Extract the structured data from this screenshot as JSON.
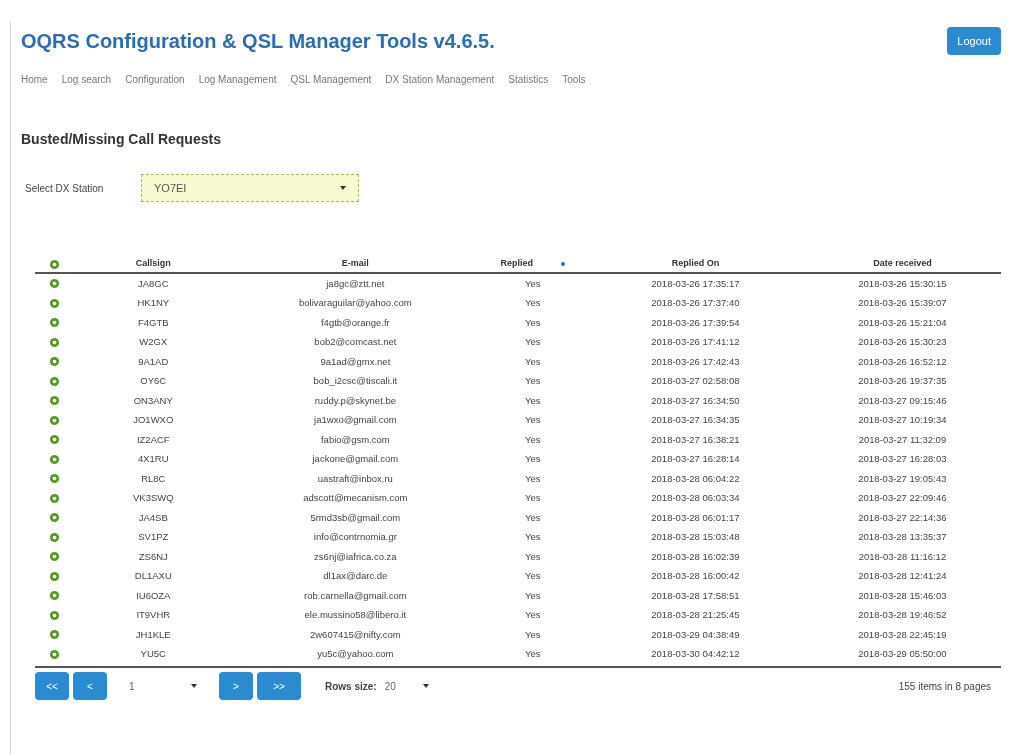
{
  "app_title": "OQRS Configuration & QSL Manager Tools v4.6.5.",
  "logout_button": "Logout",
  "nav": [
    {
      "label": "Home",
      "selected": false
    },
    {
      "label": "Log search",
      "selected": false
    },
    {
      "label": "Configuration",
      "selected": false
    },
    {
      "label": "Log Management",
      "selected": false
    },
    {
      "label": "QSL Management",
      "selected": false
    },
    {
      "label": "DX Station Management",
      "selected": false
    },
    {
      "label": "Statistics",
      "selected": false
    },
    {
      "label": "Tools",
      "selected": false
    }
  ],
  "page_heading": "Busted/Missing Call Requests",
  "station_select": {
    "label": "Select DX Station",
    "value": "YO7EI"
  },
  "table": {
    "columns": [
      "Callsign",
      "E-mail",
      "Replied",
      "Replied On",
      "Date received"
    ],
    "rows": [
      {
        "callsign": "JA8GC",
        "email": "ja8gc@ztt.net",
        "replied": "Yes",
        "replied_on": "2018-03-26 17:35:17",
        "date_received": "2018-03-26 15:30:15"
      },
      {
        "callsign": "HK1NY",
        "email": "bolivaraguilar@yahoo.com",
        "replied": "Yes",
        "replied_on": "2018-03-26 17:37:40",
        "date_received": "2018-03-26 15:39:07"
      },
      {
        "callsign": "F4GTB",
        "email": "f4gtb@orange.fr",
        "replied": "Yes",
        "replied_on": "2018-03-26 17:39:54",
        "date_received": "2018-03-26 15:21:04"
      },
      {
        "callsign": "W2GX",
        "email": "bob2@comcast.net",
        "replied": "Yes",
        "replied_on": "2018-03-26 17:41:12",
        "date_received": "2018-03-26 15:30:23"
      },
      {
        "callsign": "9A1AD",
        "email": "9a1ad@gmx.net",
        "replied": "Yes",
        "replied_on": "2018-03-26 17:42:43",
        "date_received": "2018-03-26 16:52:12"
      },
      {
        "callsign": "OY6C",
        "email": "bob_i2csc@tiscali.it",
        "replied": "Yes",
        "replied_on": "2018-03-27 02:58:08",
        "date_received": "2018-03-26 19:37:35"
      },
      {
        "callsign": "ON3ANY",
        "email": "ruddy.p@skynet.be",
        "replied": "Yes",
        "replied_on": "2018-03-27 16:34:50",
        "date_received": "2018-03-27 09:15:46"
      },
      {
        "callsign": "JO1WXO",
        "email": "ja1wxo@gmail.com",
        "replied": "Yes",
        "replied_on": "2018-03-27 16:34:35",
        "date_received": "2018-03-27 10:19:34"
      },
      {
        "callsign": "IZ2ACF",
        "email": "fabio@gsm.com",
        "replied": "Yes",
        "replied_on": "2018-03-27 16:38:21",
        "date_received": "2018-03-27 11:32:09"
      },
      {
        "callsign": "4X1RU",
        "email": "jackone@gmail.com",
        "replied": "Yes",
        "replied_on": "2018-03-27 16:28:14",
        "date_received": "2018-03-27 16:28:03"
      },
      {
        "callsign": "RL8C",
        "email": "uastraft@inbox.ru",
        "replied": "Yes",
        "replied_on": "2018-03-28 06:04:22",
        "date_received": "2018-03-27 19:05:43"
      },
      {
        "callsign": "VK3SWQ",
        "email": "adscott@mecanism.com",
        "replied": "Yes",
        "replied_on": "2018-03-28 06:03:34",
        "date_received": "2018-03-27 22:09:46"
      },
      {
        "callsign": "JA4SB",
        "email": "5rmd3sb@gmail.com",
        "replied": "Yes",
        "replied_on": "2018-03-28 06:01:17",
        "date_received": "2018-03-27 22:14:36"
      },
      {
        "callsign": "SV1PZ",
        "email": "info@contrnomia.gr",
        "replied": "Yes",
        "replied_on": "2018-03-28 15:03:48",
        "date_received": "2018-03-28 13:35:37"
      },
      {
        "callsign": "ZS6NJ",
        "email": "zs6nj@iafrica.co.za",
        "replied": "Yes",
        "replied_on": "2018-03-28 16:02:39",
        "date_received": "2018-03-28 11:16:12"
      },
      {
        "callsign": "DL1AXU",
        "email": "dl1ax@darc.de",
        "replied": "Yes",
        "replied_on": "2018-03-28 16:00:42",
        "date_received": "2018-03-28 12:41:24"
      },
      {
        "callsign": "IU6OZA",
        "email": "rob.carnella@gmail.com",
        "replied": "Yes",
        "replied_on": "2018-03-28 17:58:51",
        "date_received": "2018-03-28 15:46:03"
      },
      {
        "callsign": "IT9VHR",
        "email": "ele.mussino58@libero.it",
        "replied": "Yes",
        "replied_on": "2018-03-28 21:25:45",
        "date_received": "2018-03-28 19:46:52"
      },
      {
        "callsign": "JH1KLE",
        "email": "2w607415@nifty.com",
        "replied": "Yes",
        "replied_on": "2018-03-29 04:38:49",
        "date_received": "2018-03-28 22:45:19"
      },
      {
        "callsign": "YU5C",
        "email": "yu5c@yahoo.com",
        "replied": "Yes",
        "replied_on": "2018-03-30 04:42:12",
        "date_received": "2018-03-29 05:50:00"
      }
    ]
  },
  "pager": {
    "first": "<<",
    "prev": "<",
    "page": "1",
    "next": ">",
    "last": ">>",
    "rows_label": "Rows size:",
    "rows_value": "20",
    "summary": "155 items in 8 pages"
  }
}
